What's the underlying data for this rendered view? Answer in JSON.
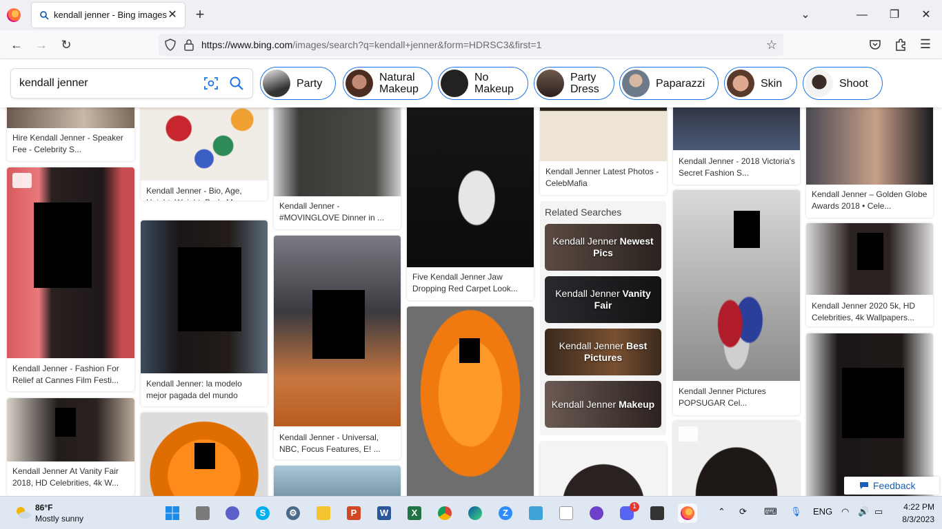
{
  "browser": {
    "tab_title": "kendall jenner - Bing images",
    "tab_close": "✕",
    "new_tab": "+",
    "url_host": "https://www.bing.com",
    "url_path": "/images/search?q=kendall+jenner&form=HDRSC3&first=1"
  },
  "search": {
    "query": "kendall jenner"
  },
  "pills": [
    {
      "label": "Party"
    },
    {
      "label": "Natural Makeup"
    },
    {
      "label": "No Makeup"
    },
    {
      "label": "Party Dress"
    },
    {
      "label": "Paparazzi"
    },
    {
      "label": "Skin"
    },
    {
      "label": "Shoot"
    }
  ],
  "cards": [
    {
      "caption": "Hire Kendall Jenner - Speaker Fee - Celebrity S..."
    },
    {
      "caption": "Kendall Jenner - Fashion For Relief at Cannes Film Festi..."
    },
    {
      "caption": "Kendall Jenner At Vanity Fair 2018, HD Celebrities, 4k W..."
    },
    {
      "caption": "Kendall Jenner - Bio, Age, Height, Weight, Body Mea..."
    },
    {
      "caption": "Kendall Jenner: la modelo mejor pagada del mundo"
    },
    {
      "caption": "Kendall Jenner - #MOVINGLOVE Dinner in ..."
    },
    {
      "caption": "Kendall Jenner - Universal, NBC, Focus Features, E! ..."
    },
    {
      "caption": "Five Kendall Jenner Jaw Dropping Red Carpet Look..."
    },
    {
      "caption": "Kendall Jenner Latest Photos - CelebMafia"
    },
    {
      "caption": "Kendall Jenner - 2018 Victoria's Secret Fashion S..."
    },
    {
      "caption": "Kendall Jenner Pictures POPSUGAR Cel..."
    },
    {
      "caption": "Kendall Jenner – Golden Globe Awards 2018 • Cele..."
    },
    {
      "caption": "Kendall Jenner 2020 5k, HD Celebrities, 4k Wallpapers..."
    }
  ],
  "related": {
    "title": "Related Searches",
    "items": [
      {
        "prefix": "Kendall Jenner ",
        "bold": "Newest Pics"
      },
      {
        "prefix": "Kendall Jenner ",
        "bold": "Vanity Fair"
      },
      {
        "prefix": "Kendall Jenner ",
        "bold": "Best Pictures"
      },
      {
        "prefix": "Kendall Jenner ",
        "bold": "Makeup"
      }
    ]
  },
  "feedback": {
    "label": "Feedback"
  },
  "taskbar": {
    "weather_temp": "86°F",
    "weather_desc": "Mostly sunny",
    "discord_badge": "1",
    "language": "ENG",
    "time": "4:22 PM",
    "date": "8/3/2023"
  },
  "colors": {
    "accent": "#1a73e8",
    "firefox": "#ff7139",
    "taskbar_bg": "#dfe7f3"
  }
}
